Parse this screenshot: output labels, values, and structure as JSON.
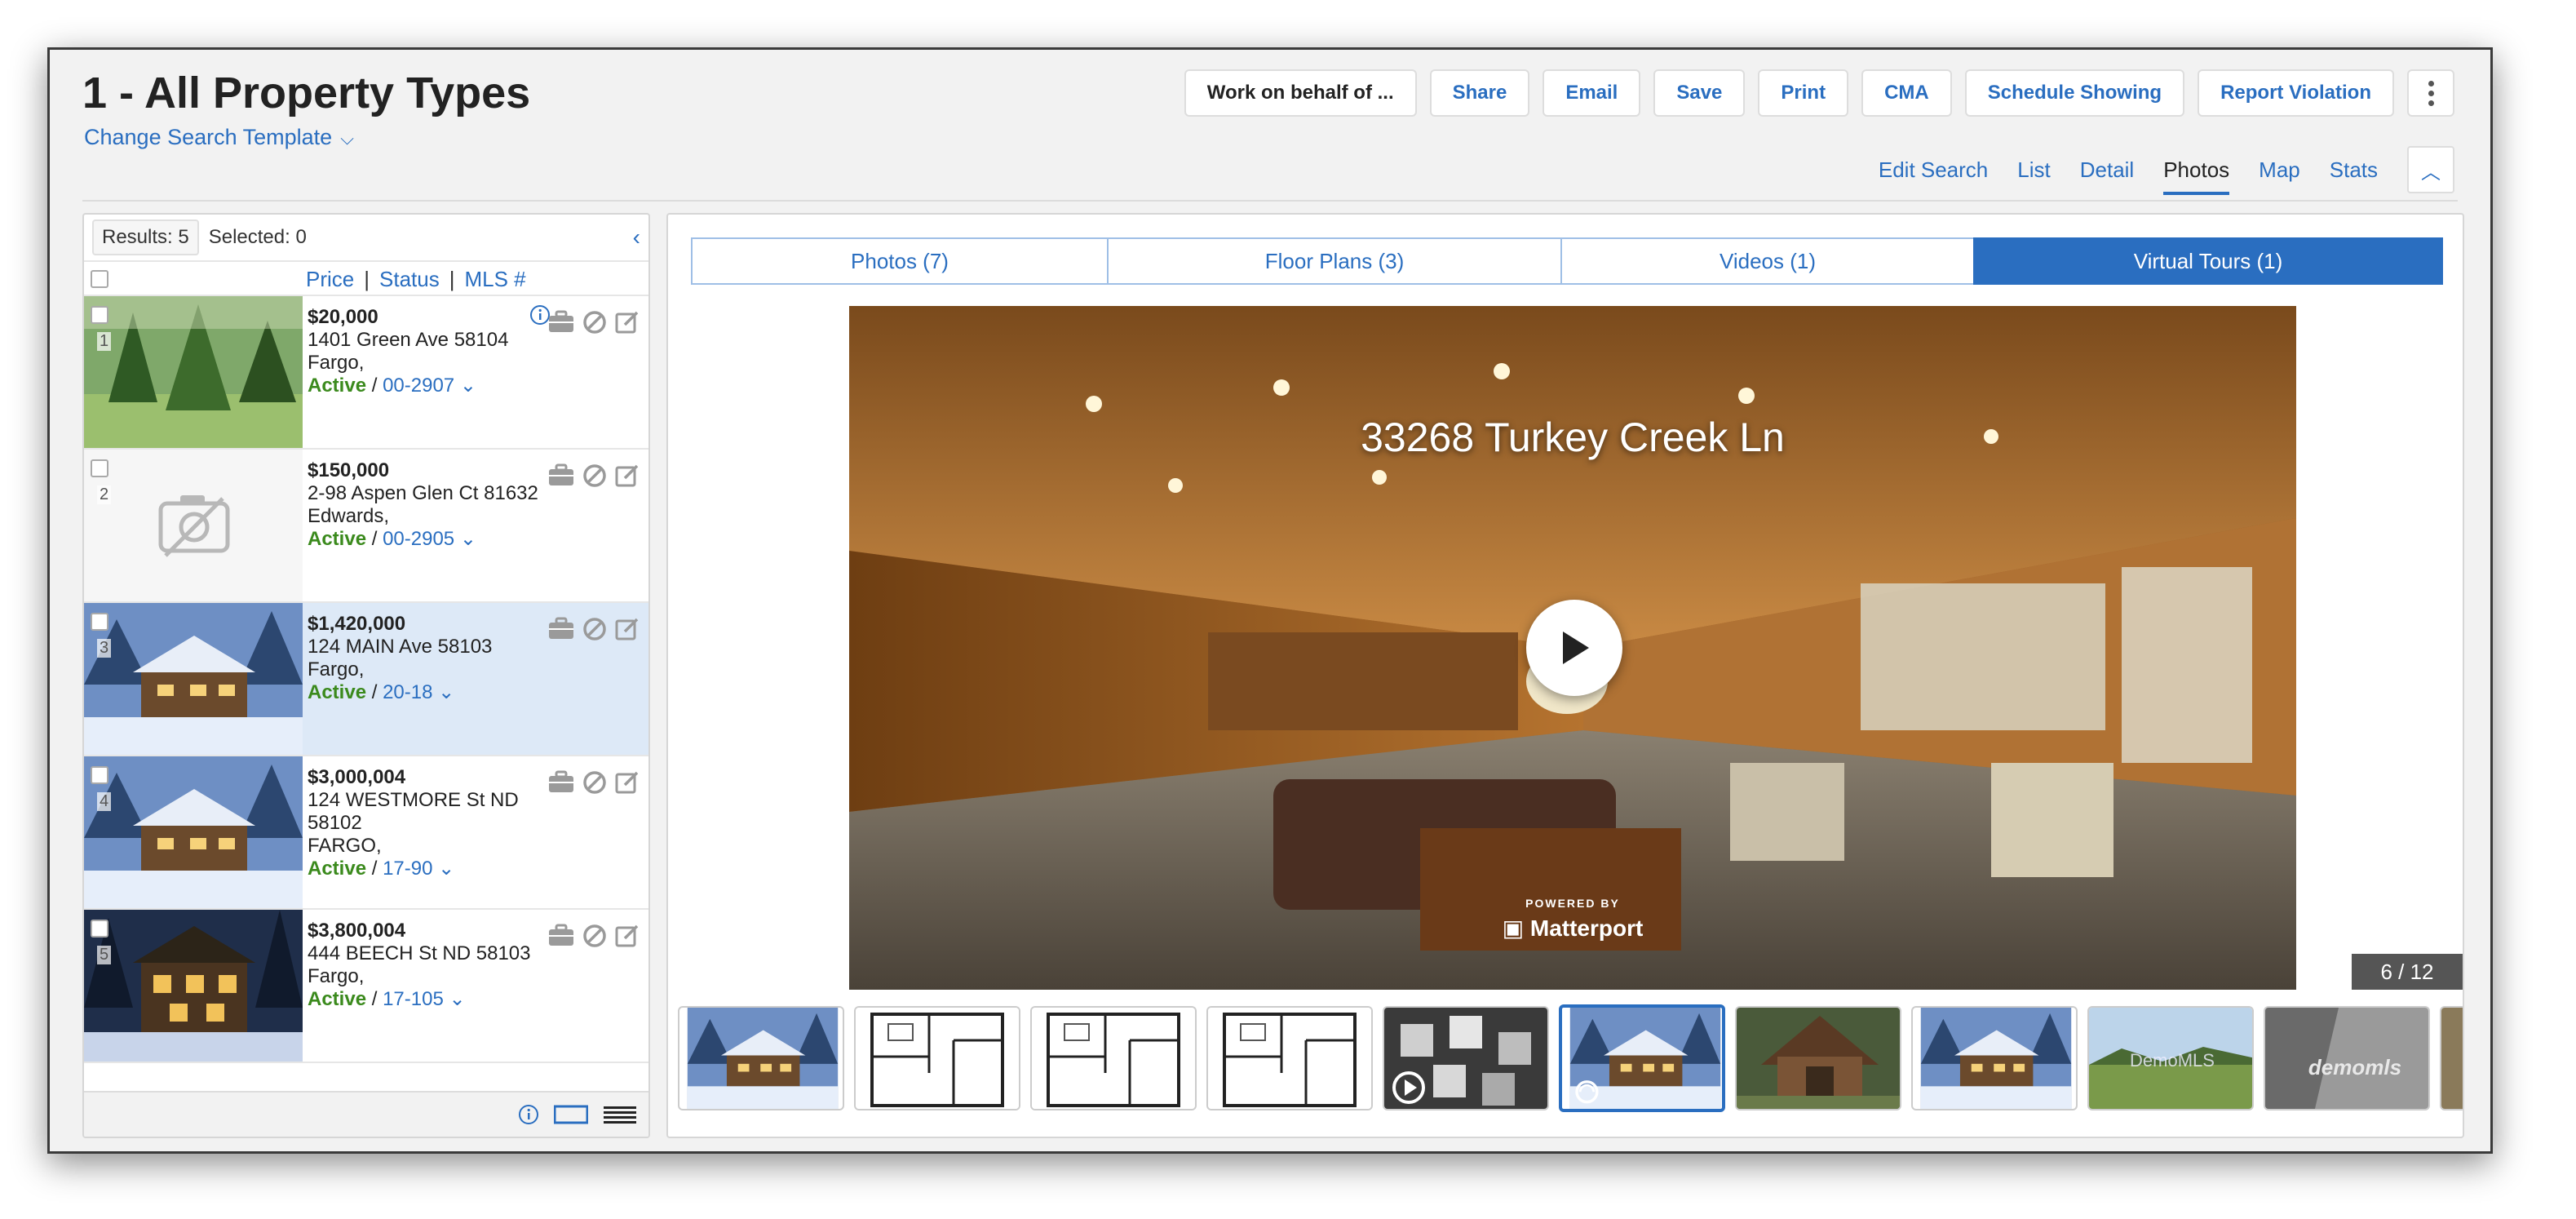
{
  "header": {
    "title": "1 - All Property Types",
    "template_link": "Change Search Template"
  },
  "actions": [
    {
      "label": "Work on behalf of ...",
      "name": "work-on-behalf-button"
    },
    {
      "label": "Share",
      "name": "share-button"
    },
    {
      "label": "Email",
      "name": "email-button"
    },
    {
      "label": "Save",
      "name": "save-button"
    },
    {
      "label": "Print",
      "name": "print-button"
    },
    {
      "label": "CMA",
      "name": "cma-button"
    },
    {
      "label": "Schedule Showing",
      "name": "schedule-showing-button"
    },
    {
      "label": "Report Violation",
      "name": "report-violation-button"
    }
  ],
  "view_tabs": [
    "Edit Search",
    "List",
    "Detail",
    "Photos",
    "Map",
    "Stats"
  ],
  "active_view": "Photos",
  "results": {
    "count_label": "Results: 5",
    "selected_label": "Selected: 0",
    "sort_price": "Price",
    "sort_status": "Status",
    "sort_mls": "MLS #",
    "sep": "|"
  },
  "listings": [
    {
      "num": "1",
      "price": "$20,000",
      "address": "1401 Green Ave 58104",
      "city": "Fargo,",
      "status": "Active",
      "mls": "00-2907",
      "image": "forest"
    },
    {
      "num": "2",
      "price": "$150,000",
      "address": "2-98 Aspen Glen Ct 81632",
      "city": "Edwards,",
      "status": "Active",
      "mls": "00-2905",
      "image": "none"
    },
    {
      "num": "3",
      "price": "$1,420,000",
      "address": "124 MAIN Ave 58103",
      "city": "Fargo,",
      "status": "Active",
      "mls": "20-18",
      "image": "snow"
    },
    {
      "num": "4",
      "price": "$3,000,004",
      "address": "124 WESTMORE St ND 58102",
      "city": "FARGO,",
      "status": "Active",
      "mls": "17-90",
      "image": "snow"
    },
    {
      "num": "5",
      "price": "$3,800,004",
      "address": "444 BEECH St ND 58103",
      "city": "Fargo,",
      "status": "Active",
      "mls": "17-105",
      "image": "night"
    }
  ],
  "status_sep": " / ",
  "media_tabs": [
    {
      "label": "Photos (7)",
      "active": false
    },
    {
      "label": "Floor Plans (3)",
      "active": false
    },
    {
      "label": "Videos (1)",
      "active": false
    },
    {
      "label": "Virtual Tours (1)",
      "active": true
    }
  ],
  "viewer": {
    "title": "33268 Turkey Creek Ln",
    "powered_by": "POWERED BY",
    "brand": "Matterport",
    "counter": "6 / 12"
  },
  "thumbnails": [
    {
      "kind": "snow"
    },
    {
      "kind": "floorplan"
    },
    {
      "kind": "floorplan"
    },
    {
      "kind": "floorplan"
    },
    {
      "kind": "video"
    },
    {
      "kind": "tour",
      "active": true
    },
    {
      "kind": "cabin"
    },
    {
      "kind": "snow"
    },
    {
      "kind": "field",
      "text": "DemoMLS"
    },
    {
      "kind": "gray",
      "text": "demomls"
    },
    {
      "kind": "partial"
    }
  ],
  "colors": {
    "accent": "#2a6ec0",
    "active_status": "#3b8a1d",
    "selected_row": "#dde9f7"
  }
}
